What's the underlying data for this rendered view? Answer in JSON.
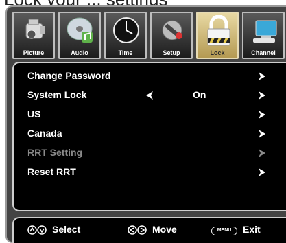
{
  "top_cut_text": "Lock your ... settings",
  "tabs": [
    {
      "label": "Picture",
      "icon": "camcorder-icon"
    },
    {
      "label": "Audio",
      "icon": "music-disc-icon"
    },
    {
      "label": "Time",
      "icon": "clock-icon"
    },
    {
      "label": "Setup",
      "icon": "tools-icon"
    },
    {
      "label": "Lock",
      "icon": "padlock-icon",
      "active": true
    },
    {
      "label": "Channel",
      "icon": "computer-icon"
    }
  ],
  "menu": [
    {
      "label": "Change Password"
    },
    {
      "label": "System Lock",
      "value": "On"
    },
    {
      "label": "US"
    },
    {
      "label": "Canada"
    },
    {
      "label": "RRT Setting",
      "disabled": true
    },
    {
      "label": "Reset RRT"
    }
  ],
  "footer": {
    "select_label": "Select",
    "move_label": "Move",
    "menu_key": "MENU",
    "exit_label": "Exit"
  },
  "colors": {
    "frame": "#444444",
    "panel": "#000000",
    "active_tab": "#d8c58a",
    "text": "#ffffff",
    "disabled_text": "#8a8a8a"
  }
}
